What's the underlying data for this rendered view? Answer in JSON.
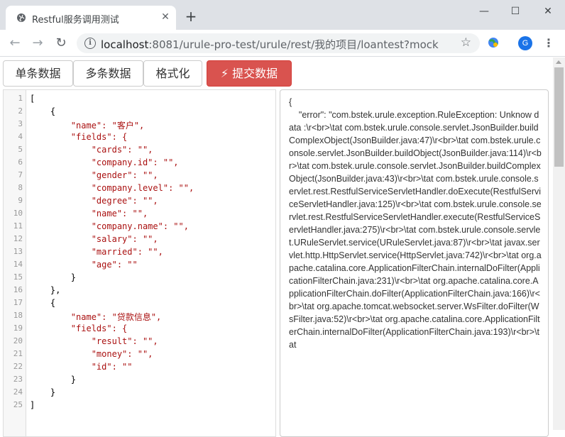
{
  "browser": {
    "tab_title": "Restful服务调用测试",
    "tab_close": "✕",
    "new_tab": "+",
    "window": {
      "minimize": "—",
      "maximize": "☐",
      "close": "✕"
    },
    "nav": {
      "back": "←",
      "forward": "→",
      "reload": "↻"
    },
    "url_host": "localhost",
    "url_rest": ":8081/urule-pro-test/urule/rest/我的项目/loantest?mock",
    "info_glyph": "i",
    "star": "☆",
    "avatar_letter": "G",
    "menu": "⋮",
    "icons": [
      "globe-icon",
      "info-icon",
      "star-icon",
      "extension-icon",
      "menu-icon"
    ]
  },
  "toolbar": {
    "single_label": "单条数据",
    "multi_label": "多条数据",
    "format_label": "格式化",
    "submit_label": "⚡ 提交数据",
    "submit_color": "#d9534f"
  },
  "editor": {
    "line_numbers": [
      "1",
      "2",
      "3",
      "4",
      "5",
      "6",
      "7",
      "8",
      "9",
      "10",
      "11",
      "12",
      "13",
      "14",
      "15",
      "16",
      "17",
      "18",
      "19",
      "20",
      "21",
      "22",
      "23",
      "24",
      "25"
    ],
    "lines": [
      "[",
      "    {",
      "        \"name\": \"客户\",",
      "        \"fields\": {",
      "            \"cards\": \"\",",
      "            \"company.id\": \"\",",
      "            \"gender\": \"\",",
      "            \"company.level\": \"\",",
      "            \"degree\": \"\",",
      "            \"name\": \"\",",
      "            \"company.name\": \"\",",
      "            \"salary\": \"\",",
      "            \"married\": \"\",",
      "            \"age\": \"\"",
      "        }",
      "    },",
      "    {",
      "        \"name\": \"贷款信息\",",
      "        \"fields\": {",
      "            \"result\": \"\",",
      "            \"money\": \"\",",
      "            \"id\": \"\"",
      "        }",
      "    }",
      "]"
    ]
  },
  "output": {
    "text": "{\n    \"error\": \"com.bstek.urule.exception.RuleException: Unknow data :\\r<br>\\tat com.bstek.urule.console.servlet.JsonBuilder.buildComplexObject(JsonBuilder.java:47)\\r<br>\\tat com.bstek.urule.console.servlet.JsonBuilder.buildObject(JsonBuilder.java:114)\\r<br>\\tat com.bstek.urule.console.servlet.JsonBuilder.buildComplexObject(JsonBuilder.java:43)\\r<br>\\tat com.bstek.urule.console.servlet.rest.RestfulServiceServletHandler.doExecute(RestfulServiceServletHandler.java:125)\\r<br>\\tat com.bstek.urule.console.servlet.rest.RestfulServiceServletHandler.execute(RestfulServiceServletHandler.java:275)\\r<br>\\tat com.bstek.urule.console.servlet.URuleServlet.service(URuleServlet.java:87)\\r<br>\\tat javax.servlet.http.HttpServlet.service(HttpServlet.java:742)\\r<br>\\tat org.apache.catalina.core.ApplicationFilterChain.internalDoFilter(ApplicationFilterChain.java:231)\\r<br>\\tat org.apache.catalina.core.ApplicationFilterChain.doFilter(ApplicationFilterChain.java:166)\\r<br>\\tat org.apache.tomcat.websocket.server.WsFilter.doFilter(WsFilter.java:52)\\r<br>\\tat org.apache.catalina.core.ApplicationFilterChain.internalDoFilter(ApplicationFilterChain.java:193)\\r<br>\\tat"
  }
}
